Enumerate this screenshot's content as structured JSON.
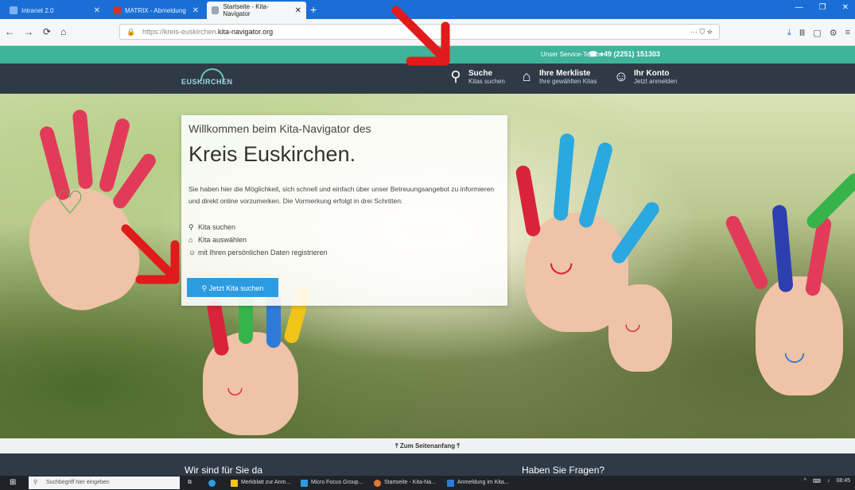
{
  "browser": {
    "tabs": [
      {
        "label": "Intranet 2.0"
      },
      {
        "label": "MATRIX - Abmeldung"
      },
      {
        "label": "Startseite - Kita-Navigator"
      }
    ],
    "url_prefix": "https://kreis-euskirchen.",
    "url_domain": "kita-navigator.org"
  },
  "servicebar": {
    "text": "Unser Service-Telefon",
    "phone": "+49 (2251) 151303"
  },
  "header": {
    "logo_text": "EUSKIRCHEN",
    "nav": [
      {
        "title": "Suche",
        "subtitle": "Kitas suchen"
      },
      {
        "title": "Ihre Merkliste",
        "subtitle": "Ihre gewählten Kitas"
      },
      {
        "title": "Ihr Konto",
        "subtitle": "Jetzt anmelden"
      }
    ]
  },
  "welcome": {
    "line1": "Willkommen beim Kita-Navigator des",
    "line2": "Kreis Euskirchen.",
    "paragraph": "Sie haben hier die Möglichkeit, sich schnell und einfach über unser Betreuungsangebot zu informieren und direkt online vorzumerken. Die Vormerkung erfolgt in drei Schritten:",
    "steps": [
      "Kita suchen",
      "Kita auswählen",
      "mit Ihren persönlichen Daten registrieren"
    ],
    "button": "Jetzt Kita suchen"
  },
  "backtop": "Zum Seitenanfang",
  "footer": {
    "left": "Wir sind für Sie da",
    "right": "Haben Sie Fragen?"
  },
  "taskbar": {
    "search_placeholder": "Suchbegriff hier eingeben",
    "apps": [
      "Merkblatt zur Anm...",
      "Micro Focus Group...",
      "Startseite - Kita-Na...",
      "Anmeldung im Kita..."
    ],
    "time": "08:45"
  },
  "colors": {
    "tabbar": "#1a6fd6",
    "service": "#3eb49a",
    "header": "#2f3a47",
    "button": "#2d9be0",
    "arrow": "#e01b1b"
  }
}
